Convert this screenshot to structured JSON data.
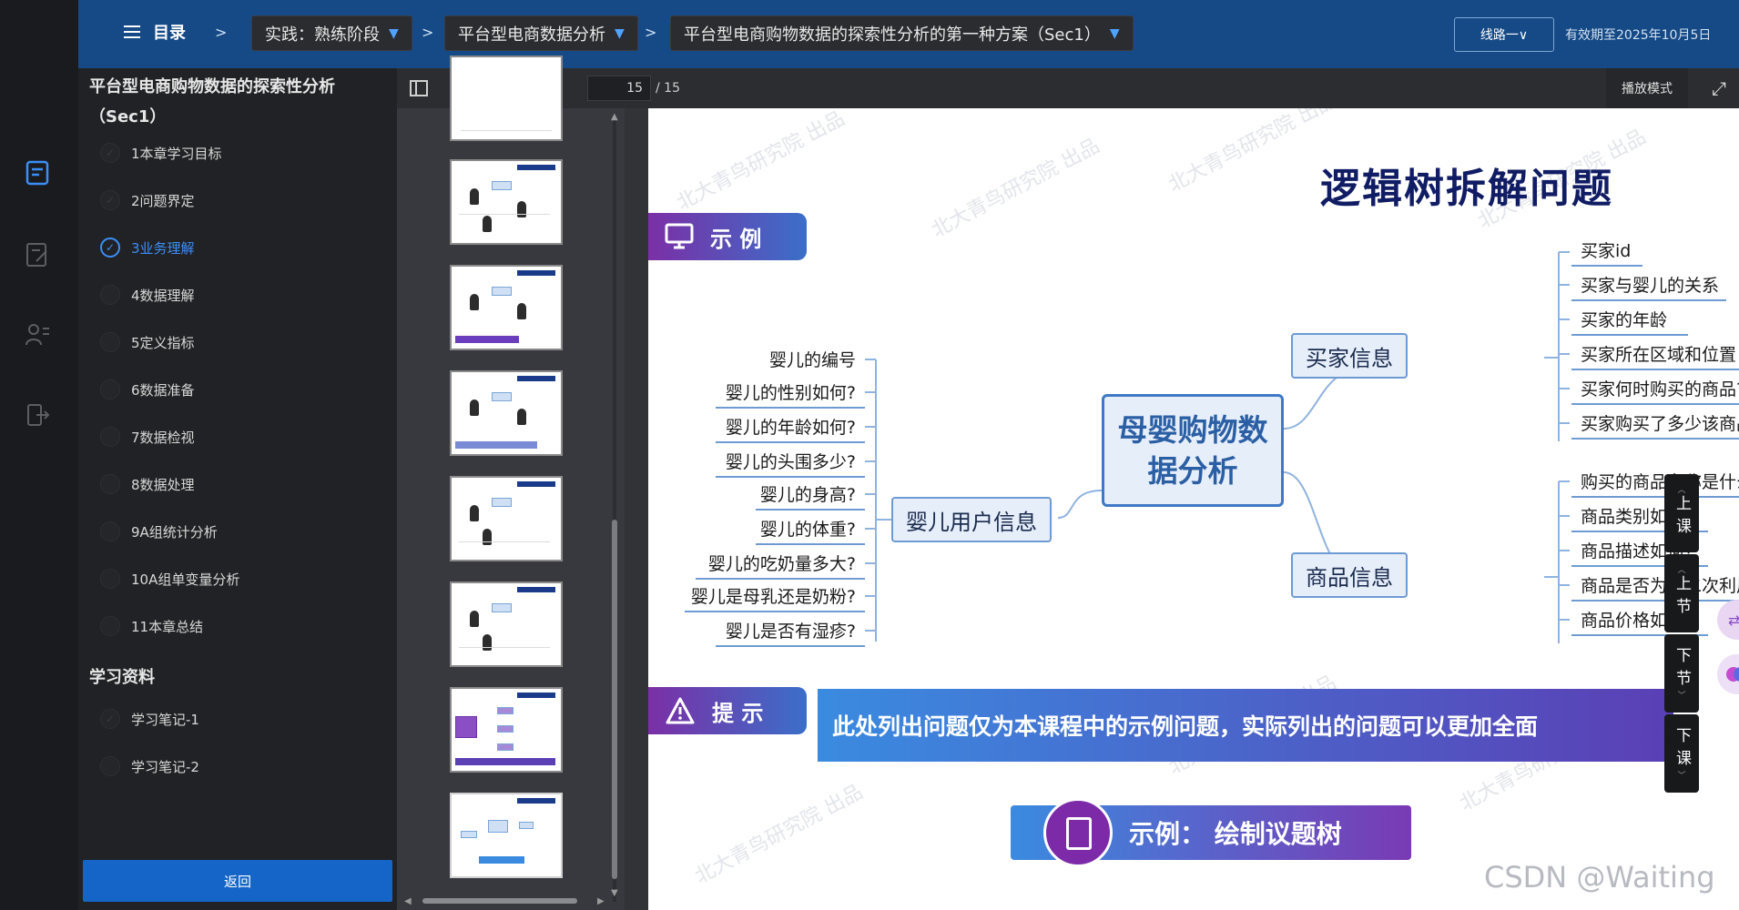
{
  "header": {
    "menu_label": "目录",
    "separator": ">",
    "crumbs": [
      "实践：熟练阶段",
      "平台型电商数据分析",
      "平台型电商购物数据的探索性分析的第一种方案（Sec1）"
    ],
    "route_button": "线路一∨",
    "valid_until": "有效期至2025年10月5日"
  },
  "rail": {
    "icons": [
      "doc-icon",
      "edit-icon",
      "people-icon",
      "exit-icon"
    ]
  },
  "chapters": {
    "title": "平台型电商购物数据的探索性分析（Sec1）",
    "items": [
      {
        "label": "1本章学习目标",
        "state": "done"
      },
      {
        "label": "2问题界定",
        "state": "done"
      },
      {
        "label": "3业务理解",
        "state": "active"
      },
      {
        "label": "4数据理解",
        "state": "none"
      },
      {
        "label": "5定义指标",
        "state": "none"
      },
      {
        "label": "6数据准备",
        "state": "none"
      },
      {
        "label": "7数据检视",
        "state": "none"
      },
      {
        "label": "8数据处理",
        "state": "none"
      },
      {
        "label": "9A组统计分析",
        "state": "none"
      },
      {
        "label": "10A组单变量分析",
        "state": "none"
      },
      {
        "label": "11本章总结",
        "state": "none"
      }
    ],
    "materials_title": "学习资料",
    "materials": [
      {
        "label": "学习笔记-1",
        "state": "done"
      },
      {
        "label": "学习笔记-2",
        "state": "none"
      }
    ],
    "return_button": "返回"
  },
  "viewer": {
    "page_current": "15",
    "page_total": "/ 15",
    "play_mode": "播放模式"
  },
  "slide": {
    "title": "逻辑树拆解问题",
    "badge_example": "示  例",
    "badge_tip": "提  示",
    "tip_text": "此处列出问题仅为本课程中的示例问题，实际列出的问题可以更加全面",
    "root": "母婴购物数据分析",
    "mid_nodes": {
      "buyer": "买家信息",
      "baby": "婴儿用户信息",
      "product": "商品信息"
    },
    "buyer_leaves": [
      "买家id",
      "买家与婴儿的关系",
      "买家的年龄",
      "买家所在区域和位置",
      "买家何时购买的商品?",
      "买家购买了多少该商品?"
    ],
    "product_leaves": [
      "购买的商品名称是什么?",
      "商品类别如何?",
      "商品描述如何?",
      "商品是否为可二次利用物品?",
      "商品价格如何?"
    ],
    "baby_leaves": [
      "婴儿的编号",
      "婴儿的性别如何?",
      "婴儿的年龄如何?",
      "婴儿的头围多少?",
      "婴儿的身高?",
      "婴儿的体重?",
      "婴儿的吃奶量多大?",
      "婴儿是母乳还是奶粉?",
      "婴儿是否有湿疹?"
    ],
    "cta": "示例：  绘制议题树",
    "watermark": "北大青鸟研究院 出品",
    "csdn": "CSDN @Waiting"
  },
  "side_nav": [
    "上课",
    "上节",
    "下节",
    "下课"
  ]
}
